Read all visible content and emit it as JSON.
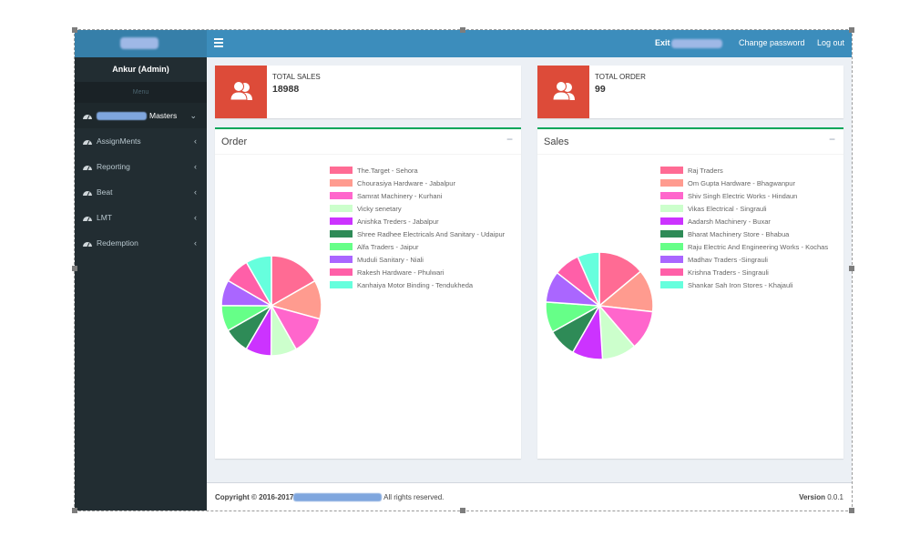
{
  "header": {
    "menu_toggle_icon": "hamburger-icon",
    "exit_label": "Exit",
    "change_password_label": "Change password",
    "logout_label": "Log out"
  },
  "sidebar": {
    "user_name": "Ankur (Admin)",
    "menu_header": "Menu",
    "items": [
      {
        "label": "Masters",
        "icon": "dashboard-icon",
        "chevron": "⌄",
        "active": true
      },
      {
        "label": "AssignMents",
        "icon": "dashboard-icon",
        "chevron": "‹"
      },
      {
        "label": "Reporting",
        "icon": "dashboard-icon",
        "chevron": "‹"
      },
      {
        "label": "Beat",
        "icon": "dashboard-icon",
        "chevron": "‹"
      },
      {
        "label": "LMT",
        "icon": "dashboard-icon",
        "chevron": "‹"
      },
      {
        "label": "Redemption",
        "icon": "dashboard-icon",
        "chevron": "‹"
      }
    ]
  },
  "info_boxes": [
    {
      "label": "TOTAL SALES",
      "value": "18988",
      "icon": "users-icon"
    },
    {
      "label": "TOTAL ORDER",
      "value": "99",
      "icon": "users-icon"
    }
  ],
  "panels": [
    {
      "title": "Order",
      "tool_icon": "−"
    },
    {
      "title": "Sales",
      "tool_icon": "−"
    }
  ],
  "footer": {
    "copyright_prefix": "Copyright © 2016-2017",
    "copyright_suffix": " All rights reserved.",
    "version_label": "Version",
    "version_value": " 0.0.1"
  },
  "colors": {
    "header": "#3c8dbc",
    "logo_bg": "#367fa9",
    "sidebar": "#222d32",
    "info_icon_bg": "#dd4b39",
    "panel_border": "#00a65a"
  },
  "chart_data": [
    {
      "type": "pie",
      "title": "Order",
      "legend": "right",
      "value_unit": "percent share (estimated from slice angles)",
      "labels": [
        "The.Target - Sehora",
        "Chourasiya Hardware - Jabalpur",
        "Samrat Machinery - Kurhani",
        "Vicky senetary",
        "Anishka Treders - Jabalpur",
        "Shree Radhee Electricals And Sanitary - Udaipur",
        "Alfa Traders - Jaipur",
        "Muduli Sanitary - Niali",
        "Rakesh Hardware - Phulwari",
        "Kanhaiya Motor Binding - Tendukheda"
      ],
      "values": [
        16.7,
        12.5,
        12.5,
        8.3,
        8.3,
        8.3,
        8.3,
        8.3,
        8.3,
        8.3
      ],
      "colors": [
        "#ff6b94",
        "#ff9b8f",
        "#ff66cc",
        "#ccffcc",
        "#cc33ff",
        "#2e8b57",
        "#66ff88",
        "#aa66ff",
        "#ff5fa8",
        "#66ffdd"
      ]
    },
    {
      "type": "pie",
      "title": "Sales",
      "legend": "right",
      "value_unit": "percent share (estimated from slice angles)",
      "labels": [
        "Raj Traders",
        "Om Gupta Hardware - Bhagwanpur",
        "Shiv Singh Electric Works - Hindaun",
        "Vikas Electrical - Singrauli",
        "Aadarsh Machinery - Buxar",
        "Bharat Machinery Store -  Bhabua",
        "Raju Electric And Engineering Works - Kochas",
        "Madhav Traders -Singrauli",
        "Krishna Traders - Singrauli",
        "Shankar Sah Iron Stores - Khajauli"
      ],
      "values": [
        13.9,
        12.8,
        11.9,
        10.3,
        9.2,
        8.6,
        9.2,
        9.4,
        7.8,
        6.6
      ],
      "colors": [
        "#ff6b94",
        "#ff9b8f",
        "#ff66cc",
        "#ccffcc",
        "#cc33ff",
        "#2e8b57",
        "#66ff88",
        "#aa66ff",
        "#ff5fa8",
        "#66ffdd"
      ]
    }
  ]
}
